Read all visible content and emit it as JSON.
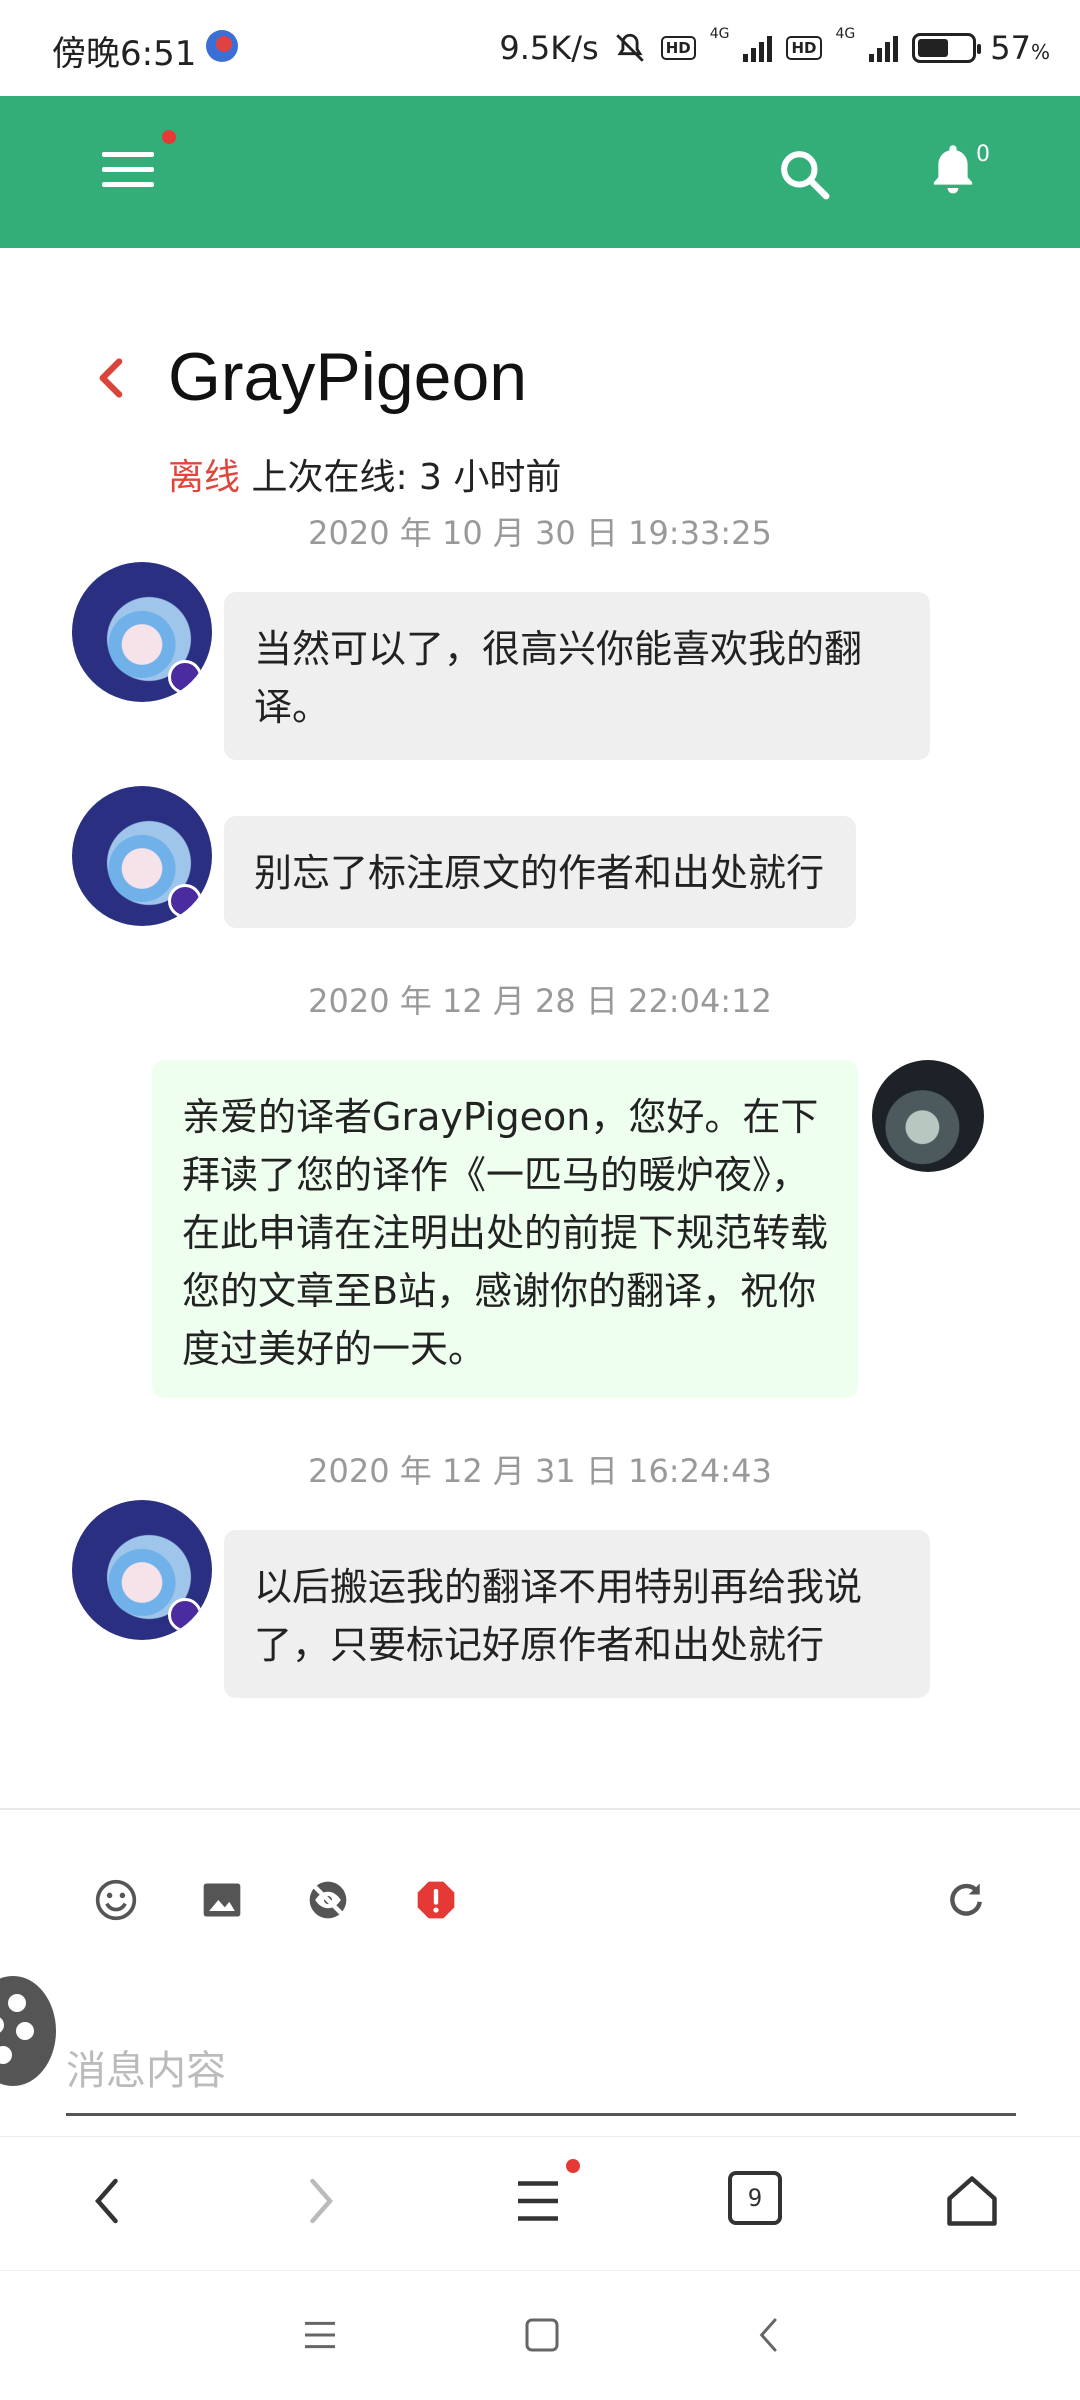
{
  "status_bar": {
    "time": "傍晚6:51",
    "net_speed": "9.5K/s",
    "hd1": "HD",
    "hd2": "HD",
    "net_type1": "4G",
    "net_type2": "4G",
    "battery": "57",
    "battery_unit": "%",
    "battery_level": 0.57
  },
  "app_bar": {
    "menu_icon": "hamburger-menu-icon",
    "search_icon": "search-icon",
    "bell_icon": "bell-icon",
    "notification_count": "0",
    "accent_color": "#34ae79"
  },
  "conversation": {
    "name": "GrayPigeon",
    "status": "离线",
    "last_seen": "上次在线: 3 小时前",
    "status_color": "#e0463b"
  },
  "messages": [
    {
      "timestamp": "2020 年 10 月 30 日 19:33:25"
    },
    {
      "sender": "other",
      "text": "当然可以了，很高兴你能喜欢我的翻译。"
    },
    {
      "sender": "other",
      "text": "别忘了标注原文的作者和出处就行"
    },
    {
      "timestamp": "2020 年 12 月 28 日 22:04:12"
    },
    {
      "sender": "self",
      "text": "亲爱的译者GrayPigeon，您好。在下拜读了您的译作《一匹马的暖炉夜》，在此申请在注明出处的前提下规范转载您的文章至B站，感谢你的翻译，祝你度过美好的一天。"
    },
    {
      "timestamp": "2020 年 12 月 31 日 16:24:43"
    },
    {
      "sender": "other",
      "text": "以后搬运我的翻译不用特别再给我说了，只要标记好原作者和出处就行"
    }
  ],
  "composer": {
    "placeholder": "消息内容",
    "tools": [
      "emoji-icon",
      "image-icon",
      "hide-icon",
      "alert-icon",
      "refresh-icon"
    ]
  },
  "browser_nav": {
    "tabs_count": "9",
    "icons": [
      "back-icon",
      "forward-icon",
      "menu-icon",
      "tabs-icon",
      "home-icon"
    ]
  },
  "system_nav": {
    "icons": [
      "recents-icon",
      "home-icon",
      "back-icon"
    ]
  }
}
